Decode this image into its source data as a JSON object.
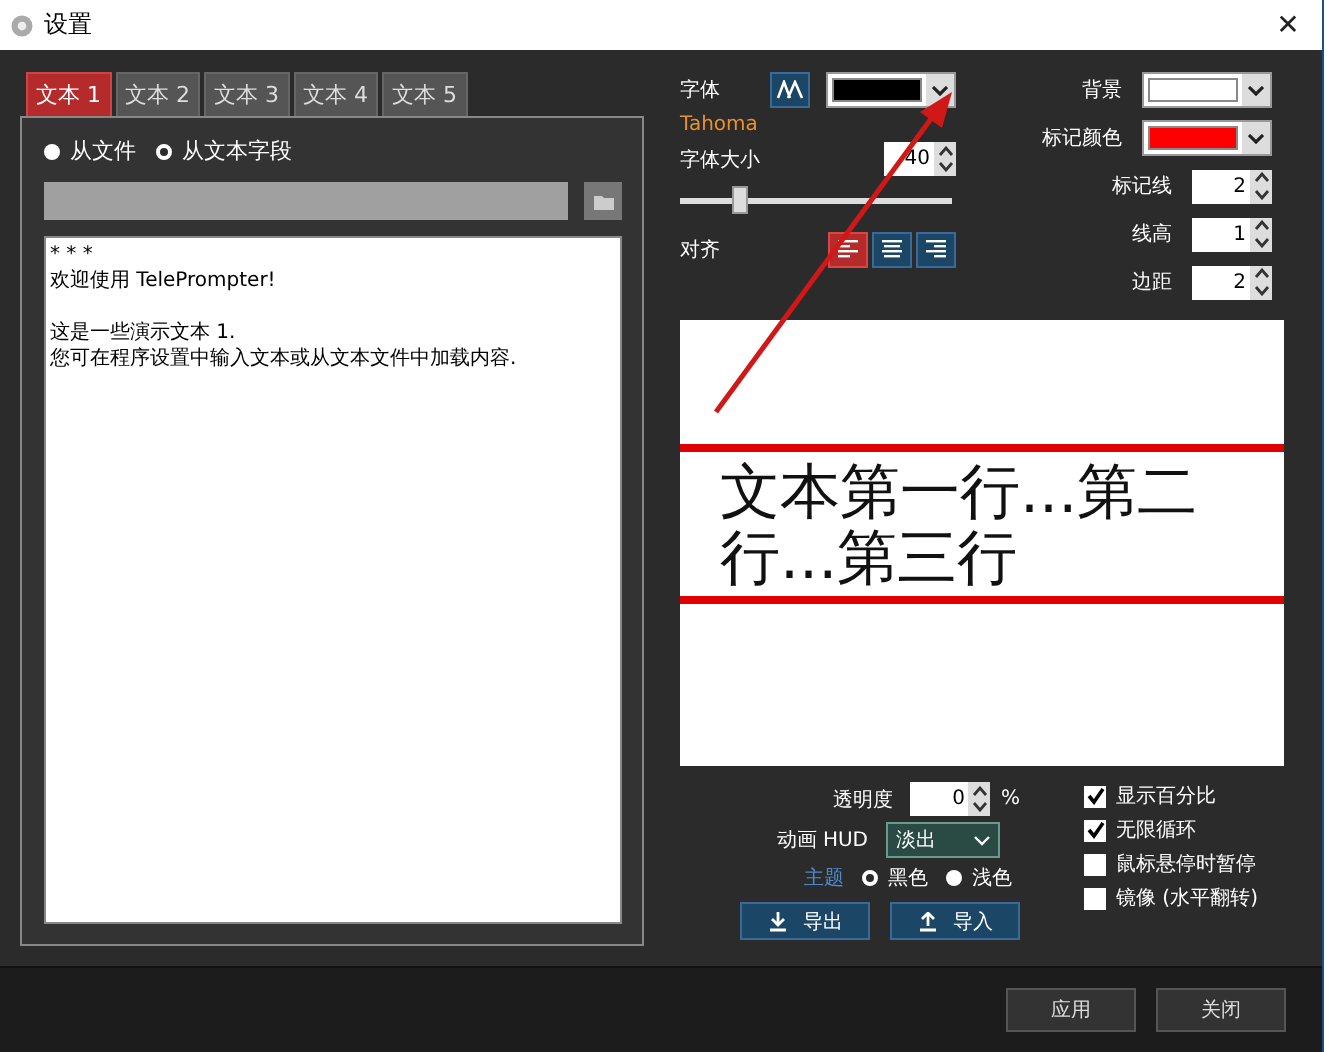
{
  "window": {
    "title": "设置",
    "close": "✕"
  },
  "tabs": [
    {
      "label": "文本 1",
      "selected": true
    },
    {
      "label": "文本 2",
      "selected": false
    },
    {
      "label": "文本 3",
      "selected": false
    },
    {
      "label": "文本 4",
      "selected": false
    },
    {
      "label": "文本 5",
      "selected": false
    }
  ],
  "source_options": [
    {
      "label": "从文件",
      "selected": false
    },
    {
      "label": "从文本字段",
      "selected": true
    }
  ],
  "text_paragraphs": [
    [
      "* * *",
      "欢迎使用 TelePrompter!"
    ],
    [
      "这是一些演示文本 1.",
      "您可在程序设置中输入文本或从文本文件中加载内容."
    ]
  ],
  "font": {
    "label": "字体",
    "name": "Tahoma",
    "color": "#000000",
    "size_label": "字体大小",
    "size": "40",
    "size_slider": {
      "level": 0.22
    },
    "align_label": "对齐",
    "align": [
      {
        "selected": true
      },
      {
        "selected": false
      },
      {
        "selected": false
      }
    ]
  },
  "right_settings": [
    {
      "kind": "color",
      "label": "背景",
      "color": "#ffffff"
    },
    {
      "kind": "color",
      "label": "标记颜色",
      "color": "#ff0000"
    },
    {
      "kind": "spin",
      "label": "标记线",
      "value": "2"
    },
    {
      "kind": "spin",
      "label": "线高",
      "value": "1"
    },
    {
      "kind": "spin",
      "label": "边距",
      "value": "2"
    }
  ],
  "preview": {
    "text": "文本第一行...第二行...第三行"
  },
  "opacity": {
    "label": "透明度",
    "value": "0",
    "unit": "%"
  },
  "hud": {
    "label": "动画 HUD",
    "value": "淡出"
  },
  "theme": {
    "label": "主题",
    "options": [
      {
        "label": "黑色",
        "selected": true
      },
      {
        "label": "浅色",
        "selected": false
      }
    ]
  },
  "io_buttons": [
    "导出",
    "导入"
  ],
  "checkboxes": [
    {
      "label": "显示百分比",
      "checked": true
    },
    {
      "label": "无限循环",
      "checked": true
    },
    {
      "label": "鼠标悬停时暂停",
      "checked": false
    },
    {
      "label": "镜像 (水平翻转)",
      "checked": false
    }
  ],
  "footer_buttons": [
    "应用",
    "关闭"
  ]
}
